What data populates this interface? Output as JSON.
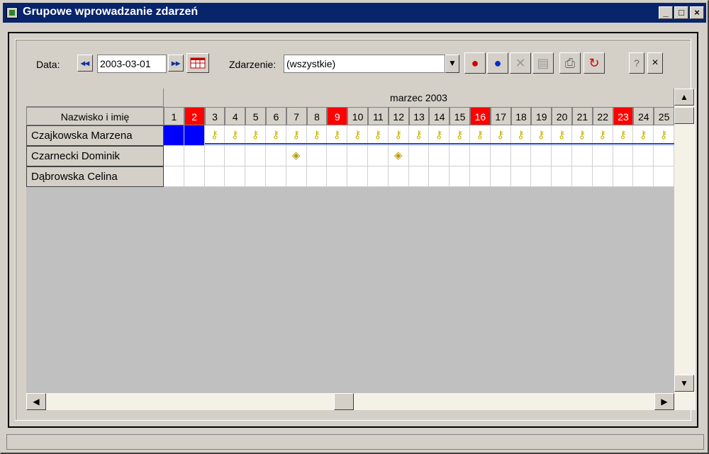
{
  "window": {
    "title": "Grupowe wprowadzanie zdarzeń",
    "buttons": [
      "_",
      "□",
      "×"
    ]
  },
  "toolbar": {
    "date_label": "Data:",
    "date_value": "2003-03-01",
    "event_label": "Zdarzenie:",
    "event_value": "(wszystkie)",
    "help_label": "?",
    "close_label": "×",
    "nav_prev": "◂◂",
    "nav_next": "▸▸"
  },
  "grid": {
    "month_label": "marzec 2003",
    "name_header": "Nazwisko i imię",
    "days": [
      "1",
      "2",
      "3",
      "4",
      "5",
      "6",
      "7",
      "8",
      "9",
      "10",
      "11",
      "12",
      "13",
      "14",
      "15",
      "16",
      "17",
      "18",
      "19",
      "20",
      "21",
      "22",
      "23",
      "24",
      "25"
    ],
    "red_days": [
      "2",
      "9",
      "16",
      "23"
    ],
    "rows": [
      {
        "name": "Czajkowska Marzena",
        "selected_days": [
          "1",
          "2"
        ],
        "icon_days": [
          "3",
          "4",
          "5",
          "6",
          "7",
          "8",
          "9",
          "10",
          "11",
          "12",
          "13",
          "14",
          "15",
          "16",
          "17",
          "18",
          "19",
          "20",
          "21",
          "22",
          "23",
          "24",
          "25"
        ],
        "icon": "key-icon"
      },
      {
        "name": "Czarnecki Dominik",
        "selected_days": [],
        "icon_days": [
          "7",
          "12"
        ],
        "icon": "tag-icon"
      },
      {
        "name": "Dąbrowska Celina",
        "selected_days": [],
        "icon_days": [],
        "icon": ""
      }
    ]
  },
  "icons": {
    "nav_prev": "rewind-icon",
    "nav_next": "fast-forward-icon",
    "calendar": "calendar-icon",
    "add_event": "add-event-icon",
    "add_info": "add-info-icon",
    "delete": "delete-icon",
    "properties": "properties-icon",
    "print": "print-icon",
    "refresh": "refresh-icon"
  },
  "colors": {
    "title_bar": "#08246b",
    "weekend_red": "#ff0000",
    "selected_blue": "#0000ff"
  }
}
